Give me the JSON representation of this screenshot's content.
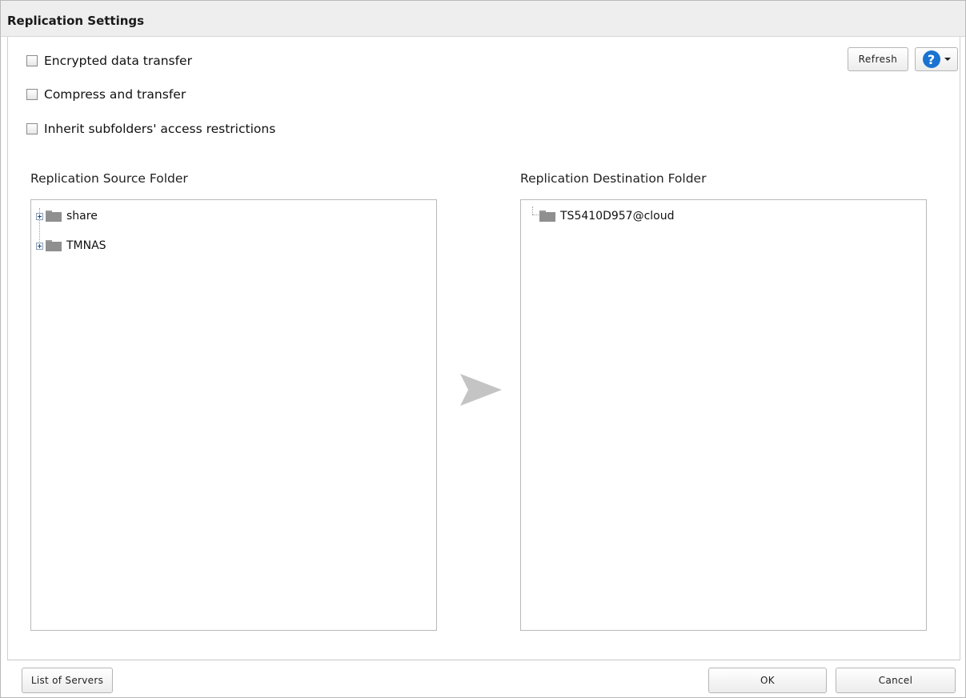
{
  "dialog": {
    "title": "Replication Settings"
  },
  "options": [
    {
      "label": "Encrypted data transfer",
      "checked": false
    },
    {
      "label": "Compress and transfer",
      "checked": false
    },
    {
      "label": "Inherit subfolders' access restrictions",
      "checked": false
    }
  ],
  "toolbar": {
    "refresh_label": "Refresh",
    "help_icon": "question-icon",
    "help_glyph": "?"
  },
  "source": {
    "label": "Replication Source Folder",
    "items": [
      {
        "name": "share",
        "expandable": true
      },
      {
        "name": "TMNAS",
        "expandable": true
      }
    ]
  },
  "destination": {
    "label": "Replication Destination Folder",
    "items": [
      {
        "name": "TS5410D957@cloud",
        "expandable": false
      }
    ]
  },
  "footer": {
    "list_servers_label": "List of Servers",
    "ok_label": "OK",
    "cancel_label": "Cancel"
  },
  "colors": {
    "accent": "#1a73d0",
    "folder": "#8f8f8f",
    "arrow": "#c4c4c4"
  }
}
